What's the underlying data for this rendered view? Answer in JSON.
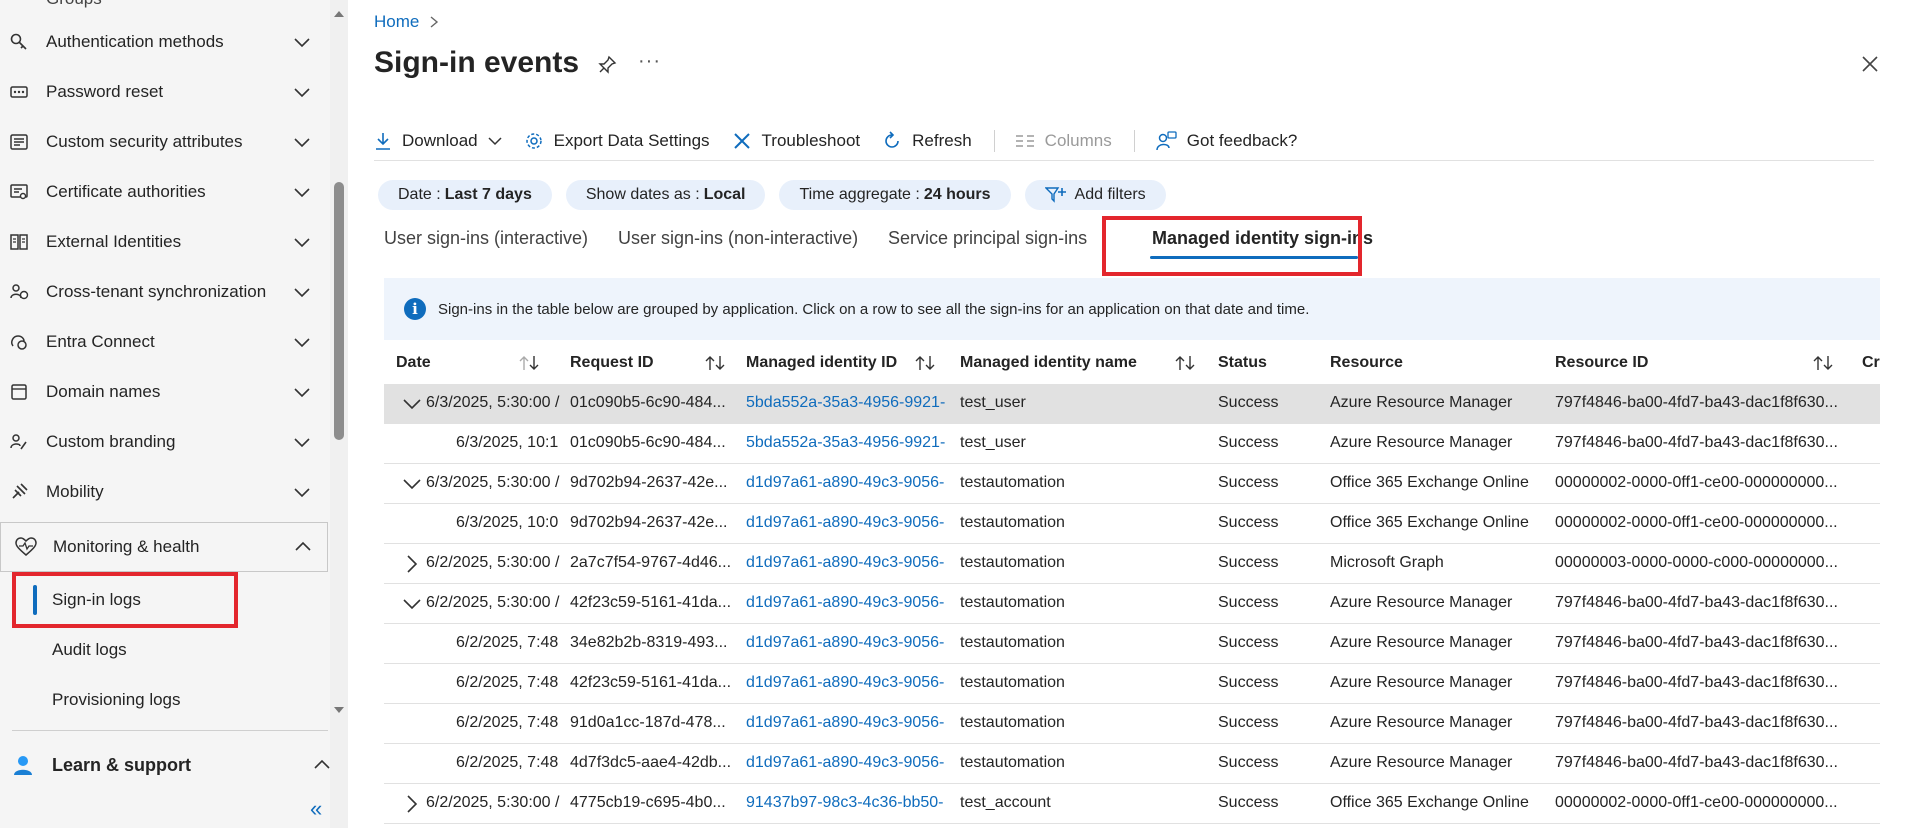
{
  "sidebar": {
    "top_partial": "Groups",
    "items": [
      {
        "label": "Authentication methods",
        "icon": "key-icon"
      },
      {
        "label": "Password reset",
        "icon": "password-icon"
      },
      {
        "label": "Custom security attributes",
        "icon": "tag-list-icon"
      },
      {
        "label": "Certificate authorities",
        "icon": "certificate-icon"
      },
      {
        "label": "External Identities",
        "icon": "external-identities-icon"
      },
      {
        "label": "Cross-tenant synchronization",
        "icon": "sync-people-icon"
      },
      {
        "label": "Entra Connect",
        "icon": "connect-icon"
      },
      {
        "label": "Domain names",
        "icon": "domain-icon"
      },
      {
        "label": "Custom branding",
        "icon": "branding-icon"
      },
      {
        "label": "Mobility",
        "icon": "mobility-icon"
      }
    ],
    "group": {
      "label": "Monitoring & health",
      "icon": "heart-pulse-icon"
    },
    "sub_items": [
      "Sign-in logs",
      "Audit logs",
      "Provisioning logs"
    ],
    "learn_support": "Learn & support",
    "collapse_glyph": "«"
  },
  "main": {
    "breadcrumb": "Home",
    "title": "Sign-in events",
    "more": "···",
    "toolbar": {
      "download": "Download",
      "export": "Export Data Settings",
      "troubleshoot": "Troubleshoot",
      "refresh": "Refresh",
      "columns": "Columns",
      "feedback": "Got feedback?"
    },
    "pills": {
      "date_label": "Date :",
      "date_value": "Last 7 days",
      "show_label": "Show dates as :",
      "show_value": "Local",
      "agg_label": "Time aggregate :",
      "agg_value": "24 hours",
      "add_filters": "Add filters"
    },
    "tabs": [
      "User sign-ins (interactive)",
      "User sign-ins (non-interactive)",
      "Service principal sign-ins",
      "Managed identity sign-ins"
    ],
    "info": "Sign-ins in the table below are grouped by application. Click on a row to see all the sign-ins for an application on that date and time.",
    "columns": [
      "Date",
      "Request ID",
      "Managed identity ID",
      "Managed identity name",
      "Status",
      "Resource",
      "Resource ID",
      "Cr"
    ],
    "rows": [
      {
        "exp": "down",
        "date": "6/3/2025, 5:30:00 /",
        "req": "01c090b5-6c90-484...",
        "mid": "5bda552a-35a3-4956-9921-",
        "name": "test_user",
        "status": "Success",
        "res": "Azure Resource Manager",
        "rid": "797f4846-ba00-4fd7-ba43-dac1f8f630..."
      },
      {
        "exp": "",
        "date": "6/3/2025, 10:1",
        "req": "01c090b5-6c90-484...",
        "mid": "5bda552a-35a3-4956-9921-",
        "name": "test_user",
        "status": "Success",
        "res": "Azure Resource Manager",
        "rid": "797f4846-ba00-4fd7-ba43-dac1f8f630..."
      },
      {
        "exp": "down",
        "date": "6/3/2025, 5:30:00 /",
        "req": "9d702b94-2637-42e...",
        "mid": "d1d97a61-a890-49c3-9056-",
        "name": "testautomation",
        "status": "Success",
        "res": "Office 365 Exchange Online",
        "rid": "00000002-0000-0ff1-ce00-000000000..."
      },
      {
        "exp": "",
        "date": "6/3/2025, 10:0",
        "req": "9d702b94-2637-42e...",
        "mid": "d1d97a61-a890-49c3-9056-",
        "name": "testautomation",
        "status": "Success",
        "res": "Office 365 Exchange Online",
        "rid": "00000002-0000-0ff1-ce00-000000000..."
      },
      {
        "exp": "right",
        "date": "6/2/2025, 5:30:00 /",
        "req": "2a7c7f54-9767-4d46...",
        "mid": "d1d97a61-a890-49c3-9056-",
        "name": "testautomation",
        "status": "Success",
        "res": "Microsoft Graph",
        "rid": "00000003-0000-0000-c000-00000000..."
      },
      {
        "exp": "down",
        "date": "6/2/2025, 5:30:00 /",
        "req": "42f23c59-5161-41da...",
        "mid": "d1d97a61-a890-49c3-9056-",
        "name": "testautomation",
        "status": "Success",
        "res": "Azure Resource Manager",
        "rid": "797f4846-ba00-4fd7-ba43-dac1f8f630..."
      },
      {
        "exp": "",
        "date": "6/2/2025, 7:48",
        "req": "34e82b2b-8319-493...",
        "mid": "d1d97a61-a890-49c3-9056-",
        "name": "testautomation",
        "status": "Success",
        "res": "Azure Resource Manager",
        "rid": "797f4846-ba00-4fd7-ba43-dac1f8f630..."
      },
      {
        "exp": "",
        "date": "6/2/2025, 7:48",
        "req": "42f23c59-5161-41da...",
        "mid": "d1d97a61-a890-49c3-9056-",
        "name": "testautomation",
        "status": "Success",
        "res": "Azure Resource Manager",
        "rid": "797f4846-ba00-4fd7-ba43-dac1f8f630..."
      },
      {
        "exp": "",
        "date": "6/2/2025, 7:48",
        "req": "91d0a1cc-187d-478...",
        "mid": "d1d97a61-a890-49c3-9056-",
        "name": "testautomation",
        "status": "Success",
        "res": "Azure Resource Manager",
        "rid": "797f4846-ba00-4fd7-ba43-dac1f8f630..."
      },
      {
        "exp": "",
        "date": "6/2/2025, 7:48",
        "req": "4d7f3dc5-aae4-42db...",
        "mid": "d1d97a61-a890-49c3-9056-",
        "name": "testautomation",
        "status": "Success",
        "res": "Azure Resource Manager",
        "rid": "797f4846-ba00-4fd7-ba43-dac1f8f630..."
      },
      {
        "exp": "right",
        "date": "6/2/2025, 5:30:00 /",
        "req": "4775cb19-c695-4b0...",
        "mid": "91437b97-98c3-4c36-bb50-",
        "name": "test_account",
        "status": "Success",
        "res": "Office 365 Exchange Online",
        "rid": "00000002-0000-0ff1-ce00-000000000..."
      }
    ]
  },
  "colors": {
    "accent": "#0f6cbd",
    "highlight": "#e3262d",
    "selected_row": "#e1e1e1"
  }
}
